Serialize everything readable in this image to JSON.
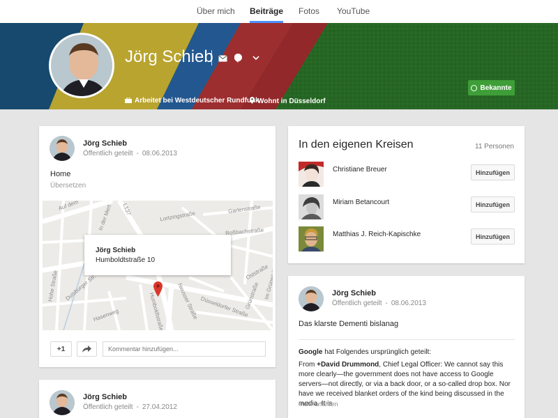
{
  "nav": {
    "tabs": [
      {
        "label": "Über mich"
      },
      {
        "label": "Beiträge"
      },
      {
        "label": "Fotos"
      },
      {
        "label": "YouTube"
      }
    ]
  },
  "profile": {
    "name": "Jörg Schieb",
    "work": "Arbeitet bei Westdeutscher Rundfunk",
    "home": "Wohnt in Düsseldorf",
    "circle_button": "Bekannte"
  },
  "post1": {
    "author": "Jörg Schieb",
    "visibility": "Öffentlich geteilt",
    "date": "08.06.2013",
    "text": "Home",
    "translate": "Übersetzen",
    "map": {
      "popup_name": "Jörg Schieb",
      "popup_address": "Humboldtstraße 10",
      "streets": [
        "Auf dem",
        "L137",
        "Lortzingstraße",
        "Garlenstraße",
        "Roßbachstraße",
        "Oststraße",
        "Humboldtstraße",
        "Neusser Straße",
        "Düsseldorfer Straße",
        "Grünstraße",
        "Im Grünen Weg",
        "Hohe Straße",
        "In der Mert",
        "Hasenweg",
        "Duisburger Str."
      ]
    },
    "plus_label": "+1",
    "comment_placeholder": "Kommentar hinzufügen..."
  },
  "circles": {
    "title": "In den eigenen Kreisen",
    "count": "11 Personen",
    "add_label": "Hinzufügen",
    "people": [
      {
        "name": "Christiane Breuer"
      },
      {
        "name": "Miriam Betancourt"
      },
      {
        "name": "Matthias J. Reich-Kapischke"
      }
    ]
  },
  "post2": {
    "author": "Jörg Schieb",
    "visibility": "Öffentlich geteilt",
    "date": "08.06.2013",
    "text": "Das klarste Dementi bislanag",
    "shared_from": "Google",
    "shared_suffix": "hat Folgendes ursprünglich geteilt:",
    "body_prefix": "From ",
    "body_person": "+David Drummond",
    "body_rest": ", Chief Legal Officer: We cannot say this more clearly—the government does not have access to Google servers—not directly, or via a back door, or a so-called drop box. Nor have we received blanket orders of the kind being discussed in the media. It is",
    "more": "Mehr erfahren"
  },
  "post3": {
    "author": "Jörg Schieb",
    "visibility": "Öffentlich geteilt",
    "date": "27.04.2012"
  },
  "colors": {
    "accent_blue": "#4d90fe",
    "green_button": "#3e9e37",
    "background": "#e5e5e5"
  }
}
